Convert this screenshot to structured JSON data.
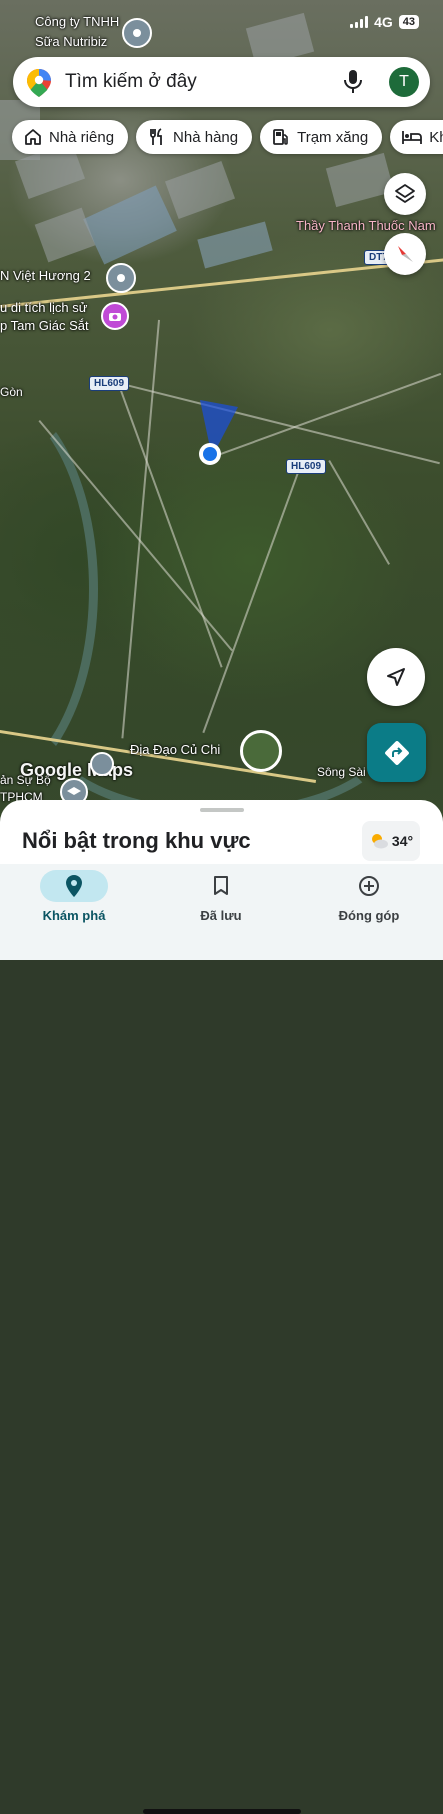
{
  "status": {
    "time": "",
    "network": "4G",
    "battery": "43"
  },
  "search": {
    "placeholder": "Tìm kiếm ở đây",
    "avatar_letter": "T"
  },
  "chips": [
    {
      "label": "Nhà riêng",
      "icon": "home-icon"
    },
    {
      "label": "Nhà hàng",
      "icon": "restaurant-icon"
    },
    {
      "label": "Trạm xăng",
      "icon": "gas-station-icon"
    },
    {
      "label": "Kh",
      "icon": "hotel-icon"
    }
  ],
  "map": {
    "labels": {
      "company": "Công ty TNHH",
      "company2": "Sữa Nutribiz",
      "thay_thanh": "Thầy Thanh Thuốc Nam",
      "viet_huong": "N Việt Hương 2",
      "di_tich": "u di tích lịch sử",
      "tam_giac": "p Tam Giác Sắt",
      "gon": "Gòn",
      "dia_dao": "Địa Đạo Củ Chi",
      "song_sai_gon": "Sông Sài Gò",
      "san_su": "ản Sự Bộ",
      "tphcm": "TPHCM",
      "google_maps": "Google Maps"
    },
    "shields": {
      "hl609_a": "HL609",
      "hl609_b": "HL609",
      "dt": "DT7"
    }
  },
  "sheet": {
    "title": "Nổi bật trong khu vực",
    "temperature": "34°"
  },
  "nav": {
    "explore": "Khám phá",
    "saved": "Đã lưu",
    "contribute": "Đóng góp"
  },
  "colors": {
    "accent": "#0b7c87",
    "nav_active_bg": "#c2e7f0",
    "location_dot": "#1a73e8"
  }
}
